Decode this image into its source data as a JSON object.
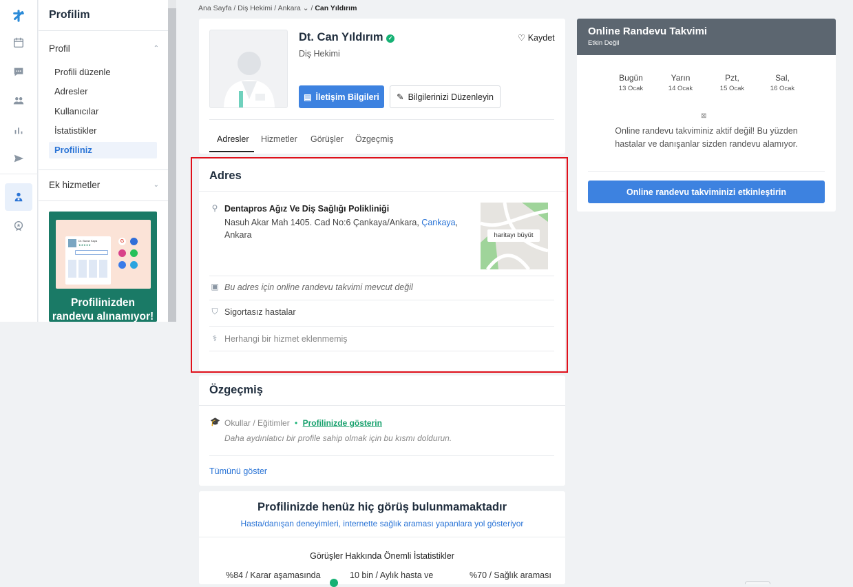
{
  "sidebar": {
    "title": "Profilim",
    "section_profile": "Profil",
    "items": [
      {
        "label": "Profili düzenle"
      },
      {
        "label": "Adresler"
      },
      {
        "label": "Kullanıcılar"
      },
      {
        "label": "İstatistikler"
      },
      {
        "label": "Profiliniz"
      }
    ],
    "section_extra": "Ek hizmetler",
    "promo_text_1": "Profilinizden",
    "promo_text_2": "randevu alınamıyor!",
    "promo_mini_name": "Dr. Buran Kaya"
  },
  "breadcrumb": {
    "home": "Ana Sayfa",
    "specialty": "Diş Hekimi",
    "city": "Ankara",
    "current": "Can Yıldırım"
  },
  "profile": {
    "name": "Dt. Can Yıldırım",
    "specialty": "Diş Hekimi",
    "save_label": "Kaydet",
    "contact_button": "İletişim Bilgileri",
    "edit_button": "Bilgilerinizi Düzenleyin",
    "tabs": [
      "Adresler",
      "Hizmetler",
      "Görüşler",
      "Özgeçmiş"
    ]
  },
  "address": {
    "heading": "Adres",
    "clinic": "Dentapros Ağız Ve Diş Sağlığı Polikliniği",
    "street": "Nasuh Akar Mah 1405. Cad No:6 Çankaya/Ankara,",
    "district": "Çankaya",
    "city": "Ankara",
    "map_button": "haritayı büyüt",
    "no_calendar": "Bu adres için online randevu takvimi mevcut değil",
    "insurance": "Sigortasız hastalar",
    "no_service": "Herhangi bir hizmet eklenmemiş"
  },
  "bio": {
    "heading": "Özgeçmiş",
    "schools": "Okullar / Eğitimler",
    "show_link": "Profilinizde gösterin",
    "hint": "Daha aydınlatıcı bir profile sahip olmak için bu kısmı doldurun.",
    "show_all": "Tümünü göster"
  },
  "reviews": {
    "heading": "Profilinizde henüz hiç görüş bulunmamaktadır",
    "sub": "Hasta/danışan deneyimleri, internette sağlık araması yapanlara yol gösteriyor",
    "stats_title": "Görüşler Hakkında Önemli İstatistikler",
    "stats": [
      "%84 / Karar aşamasında",
      "10 bin / Aylık hasta ve",
      "%70 / Sağlık araması"
    ]
  },
  "calendar": {
    "title": "Online Randevu Takvimi",
    "status": "Etkin Değil",
    "days": [
      {
        "day": "Bugün",
        "date": "13 Ocak"
      },
      {
        "day": "Yarın",
        "date": "14 Ocak"
      },
      {
        "day": "Pzt,",
        "date": "15 Ocak"
      },
      {
        "day": "Sal,",
        "date": "16 Ocak"
      }
    ],
    "message_1": "Online randevu takviminiz aktif değil! Bu yüzden",
    "message_2": "hastalar ve danışanlar sizden randevu alamıyor.",
    "activate_button": "Online randevu takviminizi etkinleştirin"
  },
  "colors": {
    "accent": "#3d82e0",
    "highlight_border": "#e0101a",
    "calendar_header": "#5c6670",
    "promo_green": "#1a7a66",
    "verified": "#16b174"
  }
}
